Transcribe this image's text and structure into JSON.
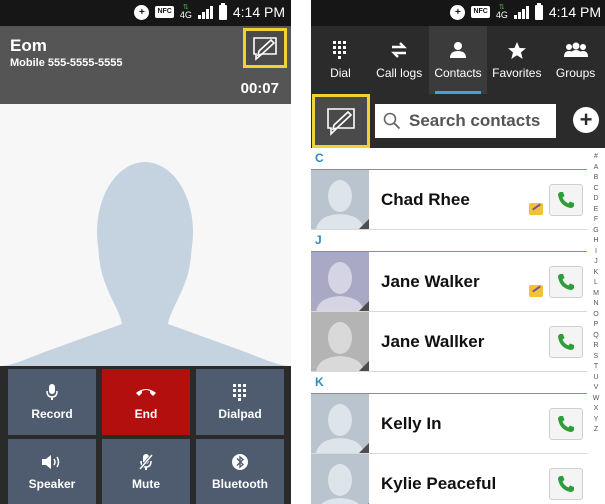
{
  "left_panel": {
    "status_bar": {
      "time": "4:14 PM",
      "network": "4G",
      "nfc": "NFC"
    },
    "caller": {
      "name": "Eom",
      "number": "Mobile 555-5555-5555",
      "timer": "00:07"
    },
    "buttons": [
      {
        "label": "Record",
        "icon": "microphone-icon"
      },
      {
        "label": "End",
        "icon": "hang-up-icon"
      },
      {
        "label": "Dialpad",
        "icon": "dialpad-icon"
      },
      {
        "label": "Speaker",
        "icon": "speaker-icon"
      },
      {
        "label": "Mute",
        "icon": "mute-icon"
      },
      {
        "label": "Bluetooth",
        "icon": "bluetooth-icon"
      }
    ]
  },
  "right_panel": {
    "status_bar": {
      "time": "4:14 PM",
      "network": "4G",
      "nfc": "NFC"
    },
    "tabs": [
      {
        "label": "Dial",
        "icon": "dialpad-icon"
      },
      {
        "label": "Call logs",
        "icon": "call-logs-icon"
      },
      {
        "label": "Contacts",
        "icon": "person-icon",
        "active": true
      },
      {
        "label": "Favorites",
        "icon": "star-icon"
      },
      {
        "label": "Groups",
        "icon": "groups-icon"
      }
    ],
    "search": {
      "placeholder": "Search contacts"
    },
    "sections": [
      {
        "letter": "C",
        "contacts": [
          {
            "name": "Chad Rhee",
            "memo": true
          }
        ]
      },
      {
        "letter": "J",
        "contacts": [
          {
            "name": "Jane Walker",
            "memo": true
          },
          {
            "name": "Jane Wallker",
            "memo": false
          }
        ]
      },
      {
        "letter": "K",
        "contacts": [
          {
            "name": "Kelly In",
            "memo": false
          },
          {
            "name": "Kylie Peaceful",
            "memo": false
          }
        ]
      }
    ],
    "index": [
      "#",
      "A",
      "B",
      "C",
      "D",
      "E",
      "F",
      "G",
      "H",
      "I",
      "J",
      "K",
      "L",
      "M",
      "N",
      "O",
      "P",
      "Q",
      "R",
      "S",
      "T",
      "U",
      "V",
      "W",
      "X",
      "Y",
      "Z"
    ]
  },
  "colors": {
    "accent": "#3aa7d6",
    "highlight": "#f2d22e",
    "end_call": "#b30f0f",
    "call_green": "#2e9e3a"
  }
}
